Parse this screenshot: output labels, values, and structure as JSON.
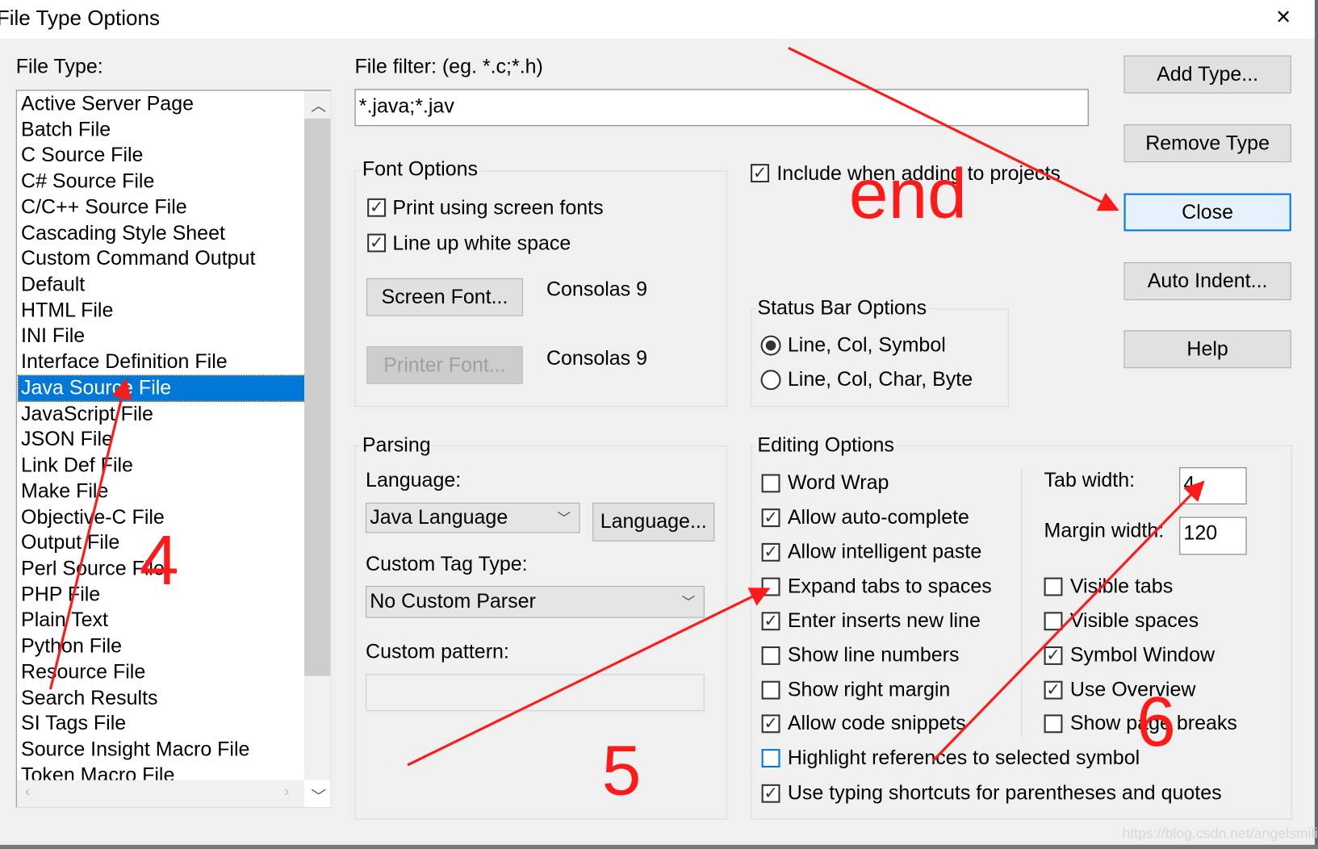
{
  "window": {
    "title": "File Type Options",
    "close_icon": "×"
  },
  "file_type": {
    "label": "File Type:",
    "items": [
      "Active Server Page",
      "Batch File",
      "C Source File",
      "C# Source File",
      "C/C++ Source File",
      "Cascading Style Sheet",
      "Custom Command Output",
      "Default",
      "HTML File",
      "INI File",
      "Interface Definition File",
      "Java Source File",
      "JavaScript File",
      "JSON File",
      "Link Def File",
      "Make File",
      "Objective-C File",
      "Output File",
      "Perl Source File",
      "PHP File",
      "Plain Text",
      "Python File",
      "Resource File",
      "Search Results",
      "SI Tags File",
      "Source Insight Macro File",
      "Token Macro File"
    ],
    "selected": "Java Source File"
  },
  "file_filter": {
    "label": "File filter: (eg. *.c;*.h)",
    "value": "*.java;*.jav"
  },
  "font_options": {
    "legend": "Font Options",
    "print_screen_fonts": {
      "label": "Print using screen fonts",
      "checked": true
    },
    "line_up_white_space": {
      "label": "Line up white space",
      "checked": true
    },
    "screen_font_button": "Screen Font...",
    "screen_font_value": "Consolas 9",
    "printer_font_button": "Printer Font...",
    "printer_font_value": "Consolas 9"
  },
  "include_projects": {
    "label": "Include when adding to projects",
    "checked": true
  },
  "status_bar": {
    "legend": "Status Bar Options",
    "options": [
      "Line, Col, Symbol",
      "Line, Col, Char, Byte"
    ],
    "selected": "Line, Col, Symbol"
  },
  "parsing": {
    "legend": "Parsing",
    "language_label": "Language:",
    "language_value": "Java Language",
    "language_button": "Language...",
    "custom_tag_label": "Custom Tag Type:",
    "custom_tag_value": "No Custom Parser",
    "custom_pattern_label": "Custom pattern:",
    "custom_pattern_value": ""
  },
  "editing": {
    "legend": "Editing Options",
    "left": [
      {
        "label": "Word Wrap",
        "checked": false
      },
      {
        "label": "Allow auto-complete",
        "checked": true
      },
      {
        "label": "Allow intelligent paste",
        "checked": true
      },
      {
        "label": "Expand tabs to spaces",
        "checked": false
      },
      {
        "label": "Enter inserts new line",
        "checked": true
      },
      {
        "label": "Show line numbers",
        "checked": false
      },
      {
        "label": "Show right margin",
        "checked": false
      },
      {
        "label": "Allow code snippets",
        "checked": true
      },
      {
        "label": "Highlight references to selected symbol",
        "checked": false
      },
      {
        "label": "Use typing shortcuts for parentheses and quotes",
        "checked": true
      }
    ],
    "tab_width_label": "Tab width:",
    "tab_width": "4",
    "margin_width_label": "Margin width:",
    "margin_width": "120",
    "right": [
      {
        "label": "Visible tabs",
        "checked": false
      },
      {
        "label": "Visible spaces",
        "checked": false
      },
      {
        "label": "Symbol Window",
        "checked": true
      },
      {
        "label": "Use Overview",
        "checked": true
      },
      {
        "label": "Show page breaks",
        "checked": false
      }
    ]
  },
  "buttons": {
    "add_type": "Add Type...",
    "remove_type": "Remove Type",
    "close": "Close",
    "auto_indent": "Auto Indent...",
    "help": "Help"
  },
  "annotations": {
    "end": "end",
    "four": "4",
    "five": "5",
    "six": "6",
    "color": "#ff1a1a"
  },
  "watermark": "https://blog.csdn.net/angelsmiling"
}
